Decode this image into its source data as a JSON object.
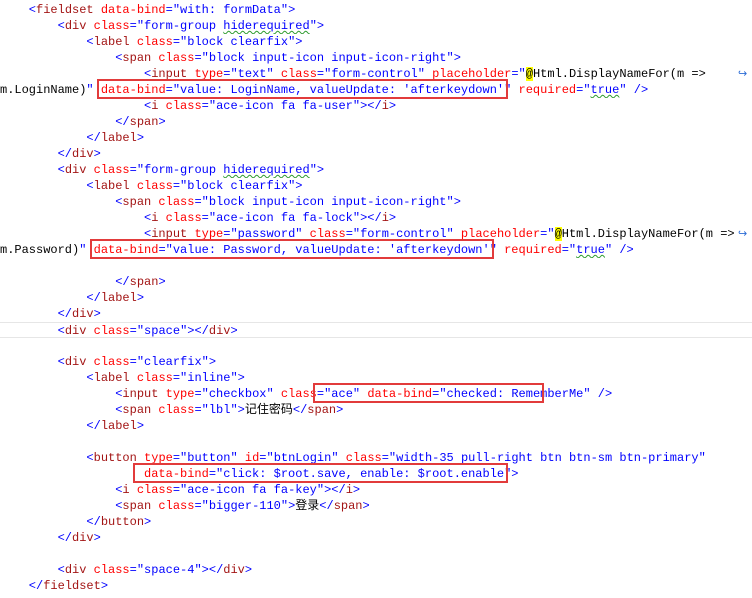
{
  "lines": [
    [
      [
        "t-punc",
        "    <"
      ],
      [
        "t-tag",
        "fieldset"
      ],
      [
        "t-attr",
        " data-bind"
      ],
      [
        "t-punc",
        "=\""
      ],
      [
        "t-val",
        "with: formData"
      ],
      [
        "t-punc",
        "\">"
      ]
    ],
    [
      [
        "t-punc",
        "        <"
      ],
      [
        "t-tag",
        "div"
      ],
      [
        "t-attr",
        " class"
      ],
      [
        "t-punc",
        "=\""
      ],
      [
        "t-val",
        "form-group "
      ],
      [
        "t-val t-squig",
        "hiderequired"
      ],
      [
        "t-punc",
        "\">"
      ]
    ],
    [
      [
        "t-punc",
        "            <"
      ],
      [
        "t-tag",
        "label"
      ],
      [
        "t-attr",
        " class"
      ],
      [
        "t-punc",
        "=\""
      ],
      [
        "t-val",
        "block clearfix"
      ],
      [
        "t-punc",
        "\">"
      ]
    ],
    [
      [
        "t-punc",
        "                <"
      ],
      [
        "t-tag",
        "span"
      ],
      [
        "t-attr",
        " class"
      ],
      [
        "t-punc",
        "=\""
      ],
      [
        "t-val",
        "block input-icon input-icon-right"
      ],
      [
        "t-punc",
        "\">"
      ]
    ],
    [
      [
        "t-punc",
        "                    <"
      ],
      [
        "t-tag",
        "input"
      ],
      [
        "t-attr",
        " type"
      ],
      [
        "t-punc",
        "=\""
      ],
      [
        "t-val",
        "text"
      ],
      [
        "t-punc",
        "\""
      ],
      [
        "t-attr",
        " class"
      ],
      [
        "t-punc",
        "=\""
      ],
      [
        "t-val",
        "form-control"
      ],
      [
        "t-punc",
        "\""
      ],
      [
        "t-attr",
        " placeholder"
      ],
      [
        "t-punc",
        "=\""
      ],
      [
        "t-razor",
        "@"
      ],
      [
        "t-txt",
        "Html.DisplayNameFor(m =>"
      ]
    ],
    [
      [
        "t-txt",
        "m.LoginName)"
      ],
      [
        "t-punc",
        "\" "
      ],
      [
        "t-attr",
        "data-bind"
      ],
      [
        "t-punc",
        "=\""
      ],
      [
        "t-val",
        "value: LoginName, valueUpdate: 'afterkeydown'"
      ],
      [
        "t-punc",
        "\" "
      ],
      [
        "t-attr",
        "required"
      ],
      [
        "t-punc",
        "=\""
      ],
      [
        "t-val t-squig",
        "true"
      ],
      [
        "t-punc",
        "\" />"
      ]
    ],
    [
      [
        "t-punc",
        "                    <"
      ],
      [
        "t-tag",
        "i"
      ],
      [
        "t-attr",
        " class"
      ],
      [
        "t-punc",
        "=\""
      ],
      [
        "t-val",
        "ace-icon fa fa-user"
      ],
      [
        "t-punc",
        "\"></"
      ],
      [
        "t-tag",
        "i"
      ],
      [
        "t-punc",
        ">"
      ]
    ],
    [
      [
        "t-punc",
        "                </"
      ],
      [
        "t-tag",
        "span"
      ],
      [
        "t-punc",
        ">"
      ]
    ],
    [
      [
        "t-punc",
        "            </"
      ],
      [
        "t-tag",
        "label"
      ],
      [
        "t-punc",
        ">"
      ]
    ],
    [
      [
        "t-punc",
        "        </"
      ],
      [
        "t-tag",
        "div"
      ],
      [
        "t-punc",
        ">"
      ]
    ],
    [
      [
        "t-punc",
        "        <"
      ],
      [
        "t-tag",
        "div"
      ],
      [
        "t-attr",
        " class"
      ],
      [
        "t-punc",
        "=\""
      ],
      [
        "t-val",
        "form-group "
      ],
      [
        "t-val t-squig",
        "hiderequired"
      ],
      [
        "t-punc",
        "\">"
      ]
    ],
    [
      [
        "t-punc",
        "            <"
      ],
      [
        "t-tag",
        "label"
      ],
      [
        "t-attr",
        " class"
      ],
      [
        "t-punc",
        "=\""
      ],
      [
        "t-val",
        "block clearfix"
      ],
      [
        "t-punc",
        "\">"
      ]
    ],
    [
      [
        "t-punc",
        "                <"
      ],
      [
        "t-tag",
        "span"
      ],
      [
        "t-attr",
        " class"
      ],
      [
        "t-punc",
        "=\""
      ],
      [
        "t-val",
        "block input-icon input-icon-right"
      ],
      [
        "t-punc",
        "\">"
      ]
    ],
    [
      [
        "t-punc",
        "                    <"
      ],
      [
        "t-tag",
        "i"
      ],
      [
        "t-attr",
        " class"
      ],
      [
        "t-punc",
        "=\""
      ],
      [
        "t-val",
        "ace-icon fa fa-lock"
      ],
      [
        "t-punc",
        "\"></"
      ],
      [
        "t-tag",
        "i"
      ],
      [
        "t-punc",
        ">"
      ]
    ],
    [
      [
        "t-punc",
        "                    <"
      ],
      [
        "t-tag",
        "input"
      ],
      [
        "t-attr",
        " type"
      ],
      [
        "t-punc",
        "=\""
      ],
      [
        "t-val",
        "password"
      ],
      [
        "t-punc",
        "\""
      ],
      [
        "t-attr",
        " class"
      ],
      [
        "t-punc",
        "=\""
      ],
      [
        "t-val",
        "form-control"
      ],
      [
        "t-punc",
        "\""
      ],
      [
        "t-attr",
        " placeholder"
      ],
      [
        "t-punc",
        "=\""
      ],
      [
        "t-razor",
        "@"
      ],
      [
        "t-txt",
        "Html.DisplayNameFor(m =>"
      ]
    ],
    [
      [
        "t-txt",
        "m.Password)"
      ],
      [
        "t-punc",
        "\" "
      ],
      [
        "t-attr",
        "data-bind"
      ],
      [
        "t-punc",
        "=\""
      ],
      [
        "t-val",
        "value: Password, valueUpdate: 'afterkeydown'"
      ],
      [
        "t-punc",
        "\" "
      ],
      [
        "t-attr",
        "required"
      ],
      [
        "t-punc",
        "=\""
      ],
      [
        "t-val t-squig",
        "true"
      ],
      [
        "t-punc",
        "\" />"
      ]
    ],
    [],
    [
      [
        "t-punc",
        "                </"
      ],
      [
        "t-tag",
        "span"
      ],
      [
        "t-punc",
        ">"
      ]
    ],
    [
      [
        "t-punc",
        "            </"
      ],
      [
        "t-tag",
        "label"
      ],
      [
        "t-punc",
        ">"
      ]
    ],
    [
      [
        "t-punc",
        "        </"
      ],
      [
        "t-tag",
        "div"
      ],
      [
        "t-punc",
        ">"
      ]
    ],
    [
      [
        "t-punc",
        "        <"
      ],
      [
        "t-tag",
        "div"
      ],
      [
        "t-attr",
        " class"
      ],
      [
        "t-punc",
        "=\""
      ],
      [
        "t-val",
        "space"
      ],
      [
        "t-punc",
        "\"></"
      ],
      [
        "t-tag",
        "div"
      ],
      [
        "t-punc",
        ">"
      ]
    ],
    [],
    [
      [
        "t-punc",
        "        <"
      ],
      [
        "t-tag",
        "div"
      ],
      [
        "t-attr",
        " class"
      ],
      [
        "t-punc",
        "=\""
      ],
      [
        "t-val",
        "clearfix"
      ],
      [
        "t-punc",
        "\">"
      ]
    ],
    [
      [
        "t-punc",
        "            <"
      ],
      [
        "t-tag",
        "label"
      ],
      [
        "t-attr",
        " class"
      ],
      [
        "t-punc",
        "=\""
      ],
      [
        "t-val",
        "inline"
      ],
      [
        "t-punc",
        "\">"
      ]
    ],
    [
      [
        "t-punc",
        "                <"
      ],
      [
        "t-tag",
        "input"
      ],
      [
        "t-attr",
        " type"
      ],
      [
        "t-punc",
        "=\""
      ],
      [
        "t-val",
        "checkbox"
      ],
      [
        "t-punc",
        "\""
      ],
      [
        "t-attr",
        " class"
      ],
      [
        "t-punc",
        "=\""
      ],
      [
        "t-val",
        "ace"
      ],
      [
        "t-punc",
        "\" "
      ],
      [
        "t-attr",
        "data-bind"
      ],
      [
        "t-punc",
        "=\""
      ],
      [
        "t-val",
        "checked: RememberMe"
      ],
      [
        "t-punc",
        "\" />"
      ]
    ],
    [
      [
        "t-punc",
        "                <"
      ],
      [
        "t-tag",
        "span"
      ],
      [
        "t-attr",
        " class"
      ],
      [
        "t-punc",
        "=\""
      ],
      [
        "t-val",
        "lbl"
      ],
      [
        "t-punc",
        "\">"
      ],
      [
        "t-txt",
        "记住密码"
      ],
      [
        "t-punc",
        "</"
      ],
      [
        "t-tag",
        "span"
      ],
      [
        "t-punc",
        ">"
      ]
    ],
    [
      [
        "t-punc",
        "            </"
      ],
      [
        "t-tag",
        "label"
      ],
      [
        "t-punc",
        ">"
      ]
    ],
    [],
    [
      [
        "t-punc",
        "            <"
      ],
      [
        "t-tag",
        "button"
      ],
      [
        "t-attr",
        " type"
      ],
      [
        "t-punc",
        "=\""
      ],
      [
        "t-val",
        "button"
      ],
      [
        "t-punc",
        "\""
      ],
      [
        "t-attr",
        " id"
      ],
      [
        "t-punc",
        "=\""
      ],
      [
        "t-val",
        "btnLogin"
      ],
      [
        "t-punc",
        "\""
      ],
      [
        "t-attr",
        " class"
      ],
      [
        "t-punc",
        "=\""
      ],
      [
        "t-val",
        "width-35 pull-right btn btn-sm btn-primary"
      ],
      [
        "t-punc",
        "\""
      ]
    ],
    [
      [
        "t-attr",
        "                    data-bind"
      ],
      [
        "t-punc",
        "=\""
      ],
      [
        "t-val",
        "click: $root.save, enable: $root.enable"
      ],
      [
        "t-punc",
        "\">"
      ]
    ],
    [
      [
        "t-punc",
        "                <"
      ],
      [
        "t-tag",
        "i"
      ],
      [
        "t-attr",
        " class"
      ],
      [
        "t-punc",
        "=\""
      ],
      [
        "t-val",
        "ace-icon fa fa-key"
      ],
      [
        "t-punc",
        "\"></"
      ],
      [
        "t-tag",
        "i"
      ],
      [
        "t-punc",
        ">"
      ]
    ],
    [
      [
        "t-punc",
        "                <"
      ],
      [
        "t-tag",
        "span"
      ],
      [
        "t-attr",
        " class"
      ],
      [
        "t-punc",
        "=\""
      ],
      [
        "t-val",
        "bigger-110"
      ],
      [
        "t-punc",
        "\">"
      ],
      [
        "t-txt",
        "登录"
      ],
      [
        "t-punc",
        "</"
      ],
      [
        "t-tag",
        "span"
      ],
      [
        "t-punc",
        ">"
      ]
    ],
    [
      [
        "t-punc",
        "            </"
      ],
      [
        "t-tag",
        "button"
      ],
      [
        "t-punc",
        ">"
      ]
    ],
    [
      [
        "t-punc",
        "        </"
      ],
      [
        "t-tag",
        "div"
      ],
      [
        "t-punc",
        ">"
      ]
    ],
    [],
    [
      [
        "t-punc",
        "        <"
      ],
      [
        "t-tag",
        "div"
      ],
      [
        "t-attr",
        " class"
      ],
      [
        "t-punc",
        "=\""
      ],
      [
        "t-val",
        "space-4"
      ],
      [
        "t-punc",
        "\"></"
      ],
      [
        "t-tag",
        "div"
      ],
      [
        "t-punc",
        ">"
      ]
    ],
    [
      [
        "t-punc",
        "    </"
      ],
      [
        "t-tag",
        "fieldset"
      ],
      [
        "t-punc",
        ">"
      ]
    ]
  ],
  "current_line": 20,
  "wrap_lines": [
    4,
    14
  ],
  "highlights": [
    {
      "line": 5,
      "from": 14,
      "len": 56
    },
    {
      "line": 15,
      "from": 13,
      "len": 55
    },
    {
      "line": 24,
      "from": 44,
      "len": 31
    },
    {
      "line": 29,
      "from": 19,
      "len": 51
    }
  ],
  "icons": {
    "wrap": "word-wrap-arrow-icon",
    "wrap_glyph": "↪"
  }
}
